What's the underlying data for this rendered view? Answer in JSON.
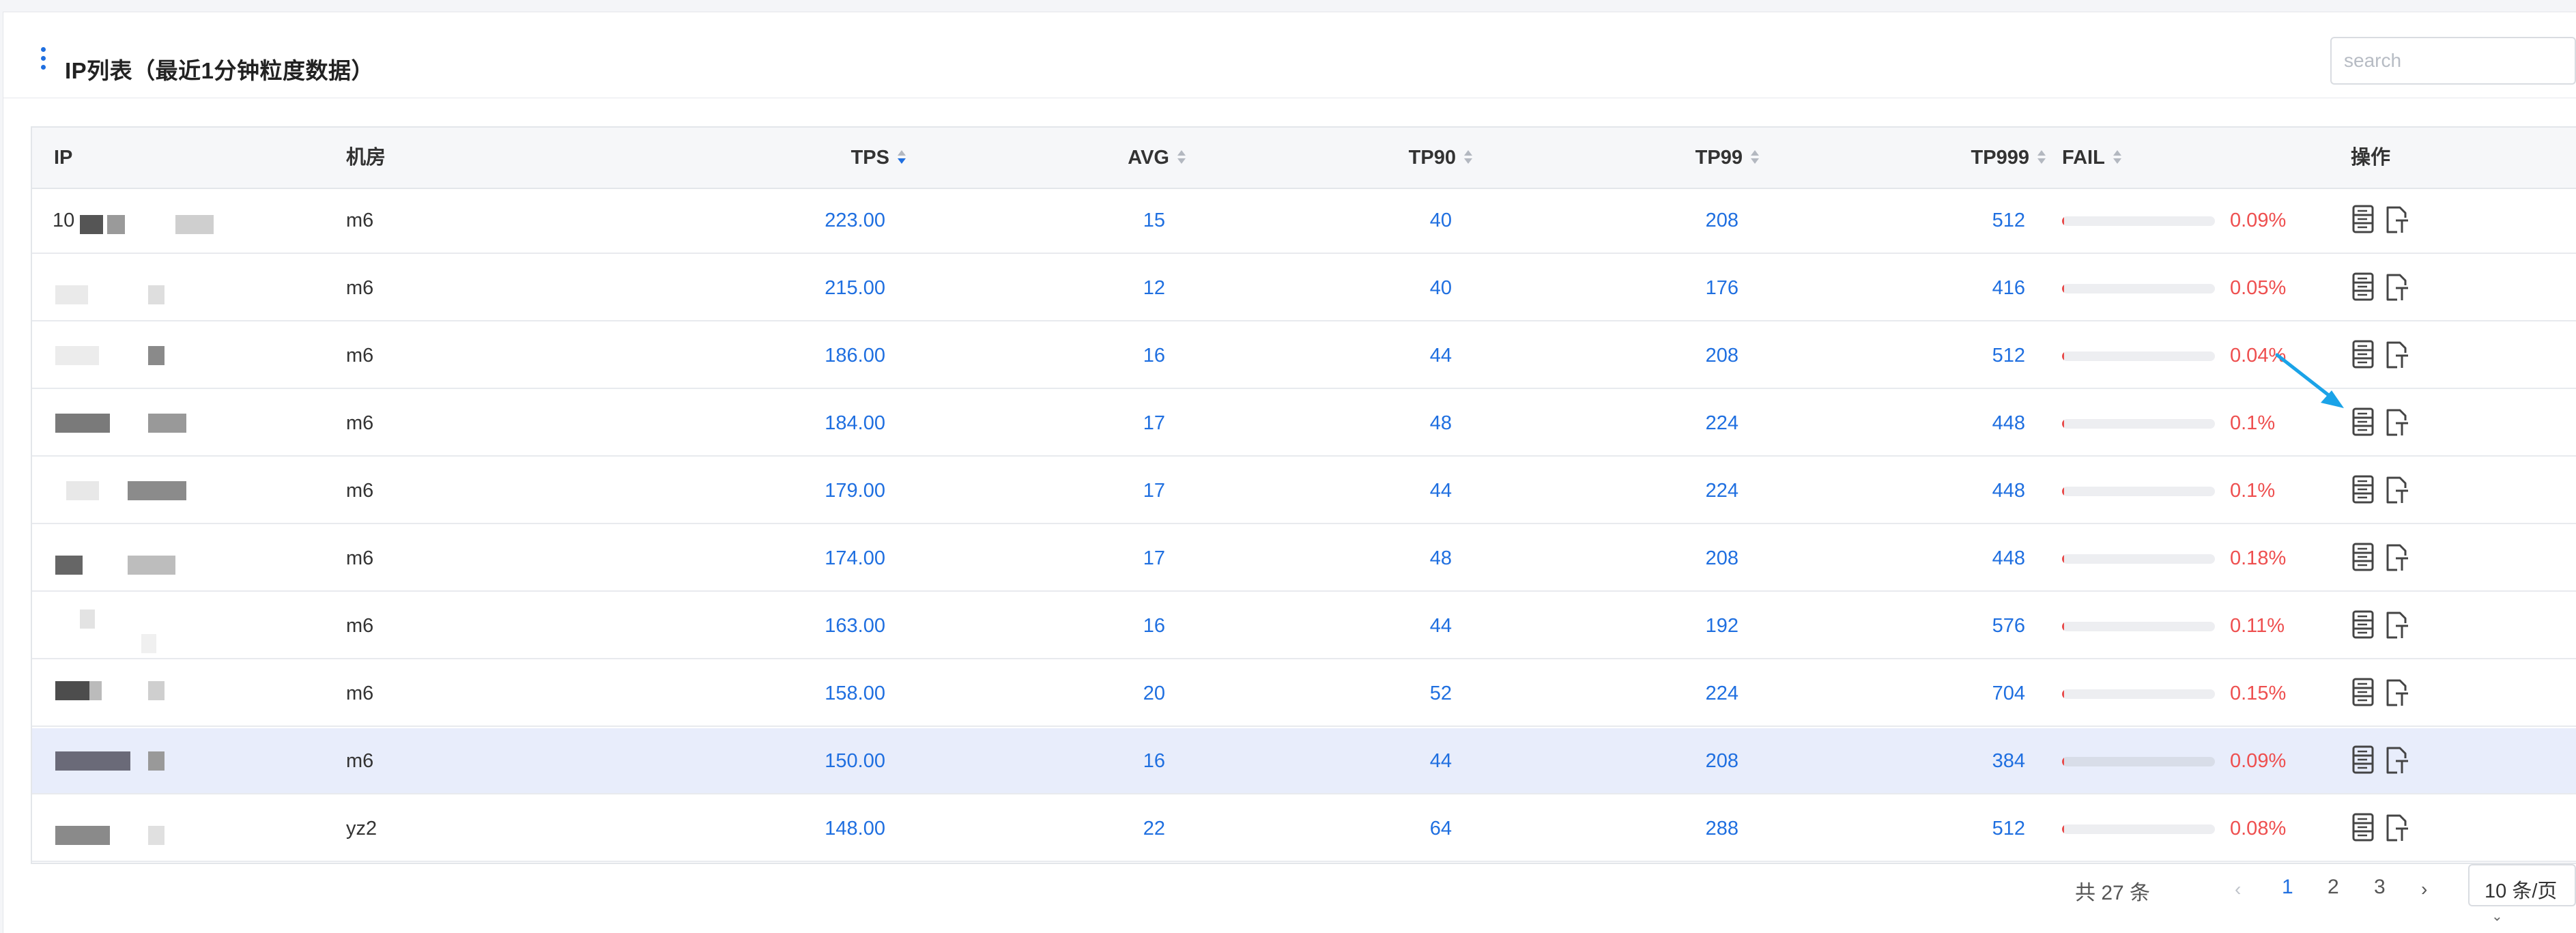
{
  "panel": {
    "title": "IP列表（最近1分钟粒度数据）",
    "search_placeholder": "search"
  },
  "columns": [
    "IP",
    "机房",
    "TPS",
    "AVG",
    "TP90",
    "TP99",
    "TP999",
    "FAIL",
    "操作"
  ],
  "rows": [
    {
      "ip": "10",
      "room": "m6",
      "tps": "223.00",
      "avg": "15",
      "tp90": "40",
      "tp99": "208",
      "tp999": "512",
      "fail": "0.09%",
      "fail_value": 0.09
    },
    {
      "ip": "",
      "room": "m6",
      "tps": "215.00",
      "avg": "12",
      "tp90": "40",
      "tp99": "176",
      "tp999": "416",
      "fail": "0.05%",
      "fail_value": 0.05
    },
    {
      "ip": "",
      "room": "m6",
      "tps": "186.00",
      "avg": "16",
      "tp90": "44",
      "tp99": "208",
      "tp999": "512",
      "fail": "0.04%",
      "fail_value": 0.04
    },
    {
      "ip": "",
      "room": "m6",
      "tps": "184.00",
      "avg": "17",
      "tp90": "48",
      "tp99": "224",
      "tp999": "448",
      "fail": "0.1%",
      "fail_value": 0.1
    },
    {
      "ip": "",
      "room": "m6",
      "tps": "179.00",
      "avg": "17",
      "tp90": "44",
      "tp99": "224",
      "tp999": "448",
      "fail": "0.1%",
      "fail_value": 0.1
    },
    {
      "ip": "",
      "room": "m6",
      "tps": "174.00",
      "avg": "17",
      "tp90": "48",
      "tp99": "208",
      "tp999": "448",
      "fail": "0.18%",
      "fail_value": 0.18
    },
    {
      "ip": "",
      "room": "m6",
      "tps": "163.00",
      "avg": "16",
      "tp90": "44",
      "tp99": "192",
      "tp999": "576",
      "fail": "0.11%",
      "fail_value": 0.11
    },
    {
      "ip": "",
      "room": "m6",
      "tps": "158.00",
      "avg": "20",
      "tp90": "52",
      "tp99": "224",
      "tp999": "704",
      "fail": "0.15%",
      "fail_value": 0.15
    },
    {
      "ip": "",
      "room": "m6",
      "tps": "150.00",
      "avg": "16",
      "tp90": "44",
      "tp99": "208",
      "tp999": "384",
      "fail": "0.09%",
      "fail_value": 0.09,
      "highlighted": true
    },
    {
      "ip": "",
      "room": "yz2",
      "tps": "148.00",
      "avg": "22",
      "tp90": "64",
      "tp99": "288",
      "tp999": "512",
      "fail": "0.08%",
      "fail_value": 0.08
    }
  ],
  "row_actions": [
    "server-detail-icon",
    "trace-icon"
  ],
  "pagination": {
    "total": "共 27 条",
    "pages": [
      "1",
      "2",
      "3"
    ],
    "current": "1",
    "page_size": "10 条/页"
  },
  "colors": {
    "accent": "#1f6fe0",
    "fail": "#ee4f4f",
    "highlight_row": "#e8edfb",
    "annotation_arrow": "#1aa3e8"
  }
}
